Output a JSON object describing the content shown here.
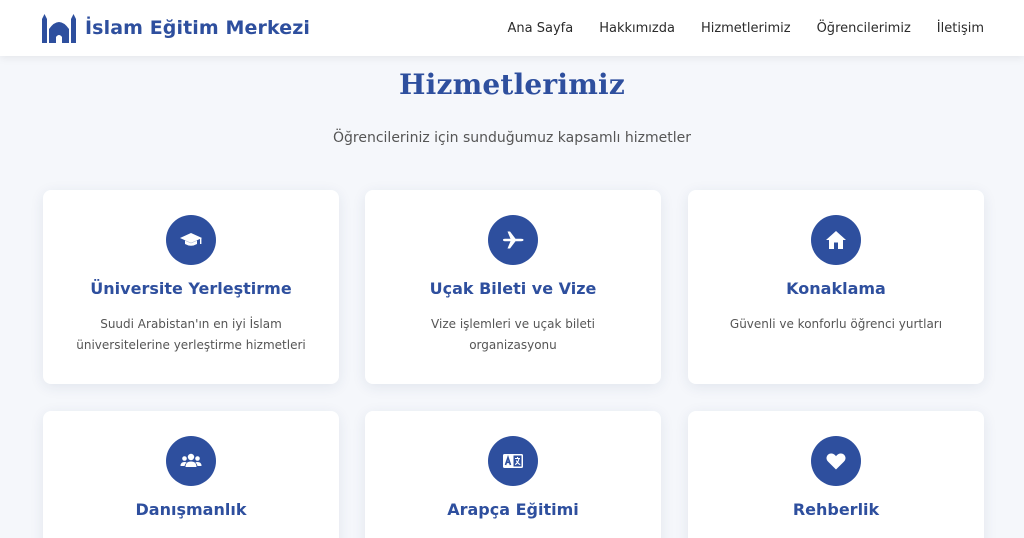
{
  "brand": {
    "name": "İslam Eğitim Merkezi"
  },
  "nav": [
    {
      "label": "Ana Sayfa"
    },
    {
      "label": "Hakkımızda"
    },
    {
      "label": "Hizmetlerimiz"
    },
    {
      "label": "Öğrencilerimiz"
    },
    {
      "label": "İletişim"
    }
  ],
  "section": {
    "title": "Hizmetlerimiz",
    "subtitle": "Öğrencileriniz için sunduğumuz kapsamlı hizmetler"
  },
  "services": [
    {
      "icon": "graduation-cap-icon",
      "title": "Üniversite Yerleştirme",
      "description": "Suudi Arabistan'ın en iyi İslam üniversitelerine yerleştirme hizmetleri"
    },
    {
      "icon": "plane-icon",
      "title": "Uçak Bileti ve Vize",
      "description": "Vize işlemleri ve uçak bileti organizasyonu"
    },
    {
      "icon": "home-icon",
      "title": "Konaklama",
      "description": "Güvenli ve konforlu öğrenci yurtları"
    },
    {
      "icon": "users-icon",
      "title": "Danışmanlık",
      "description": ""
    },
    {
      "icon": "language-icon",
      "title": "Arapça Eğitimi",
      "description": ""
    },
    {
      "icon": "heart-icon",
      "title": "Rehberlik",
      "description": ""
    }
  ],
  "colors": {
    "primary": "#2e4f9e",
    "background": "#f5f7fb",
    "card": "#ffffff"
  }
}
